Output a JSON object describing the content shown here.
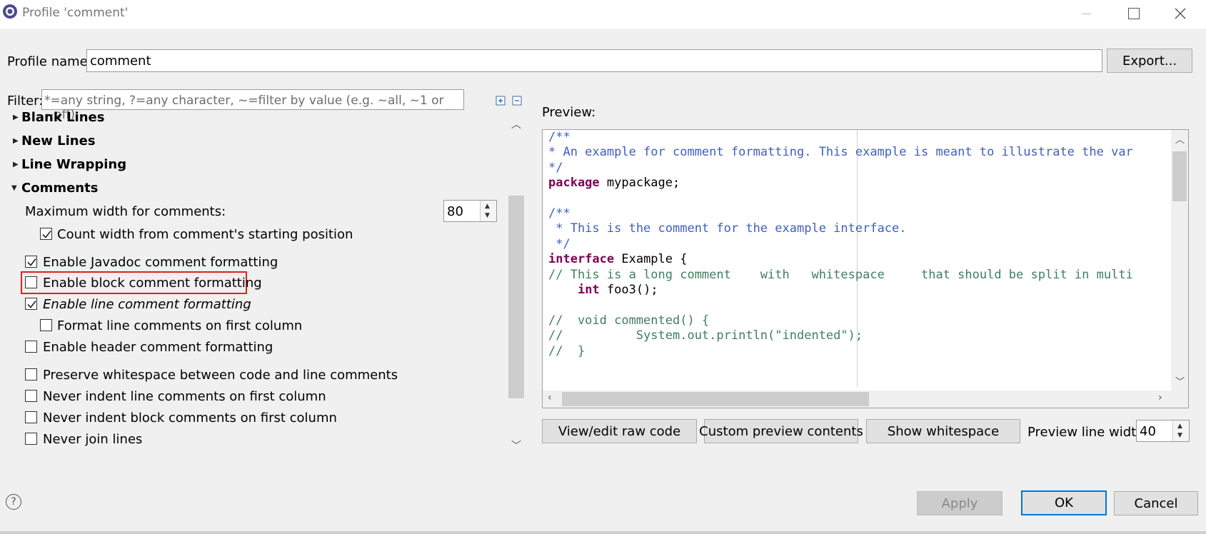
{
  "window": {
    "title": "Profile 'comment'"
  },
  "profile": {
    "name_label": "Profile name:",
    "name_value": "comment",
    "export_label": "Export..."
  },
  "filter": {
    "label": "Filter:",
    "placeholder": "*=any string, ?=any character, ~=filter by value (e.g. ~all, ~1 or ~off)"
  },
  "tree": {
    "sections": [
      {
        "label": "Blank Lines",
        "expanded": false
      },
      {
        "label": "New Lines",
        "expanded": false
      },
      {
        "label": "Line Wrapping",
        "expanded": false
      },
      {
        "label": "Comments",
        "expanded": true
      }
    ],
    "max_width_label": "Maximum width for comments:",
    "max_width_value": "80",
    "options": [
      {
        "label": "Count width from comment's starting position",
        "checked": true
      },
      {
        "label": "Enable Javadoc comment formatting",
        "checked": true
      },
      {
        "label": "Enable block comment formatting",
        "checked": false,
        "highlighted": true
      },
      {
        "label": "Enable line comment formatting",
        "checked": true,
        "italic": true
      },
      {
        "label": "Format line comments on first column",
        "checked": false
      },
      {
        "label": "Enable header comment formatting",
        "checked": false
      },
      {
        "label": "Preserve whitespace between code and line comments",
        "checked": false
      },
      {
        "label": "Never indent line comments on first column",
        "checked": false
      },
      {
        "label": "Never indent block comments on first column",
        "checked": false
      },
      {
        "label": "Never join lines",
        "checked": false
      }
    ]
  },
  "preview": {
    "label": "Preview:",
    "code_lines": [
      "/**",
      "* An example for comment formatting. This example is meant to illustrate the var",
      "*/",
      "package mypackage;",
      "",
      "/**",
      " * This is the comment for the example interface.",
      " */",
      "interface Example {",
      "// This is a long comment    with   whitespace     that should be split in multi",
      "    int foo3();",
      "",
      "//  void commented() {",
      "//          System.out.println(\"indented\");",
      "//  }"
    ],
    "view_raw_label": "View/edit raw code",
    "custom_preview_label": "Custom preview contents",
    "show_whitespace_label": "Show whitespace",
    "line_width_label": "Preview line width:",
    "line_width_value": "40"
  },
  "buttons": {
    "apply": "Apply",
    "ok": "OK",
    "cancel": "Cancel"
  },
  "colors": {
    "highlight": "#e0201f",
    "accent": "#0078d7",
    "comment_blue": "#3f5fbf",
    "comment_green": "#3f7f5f",
    "keyword": "#7f0055"
  }
}
